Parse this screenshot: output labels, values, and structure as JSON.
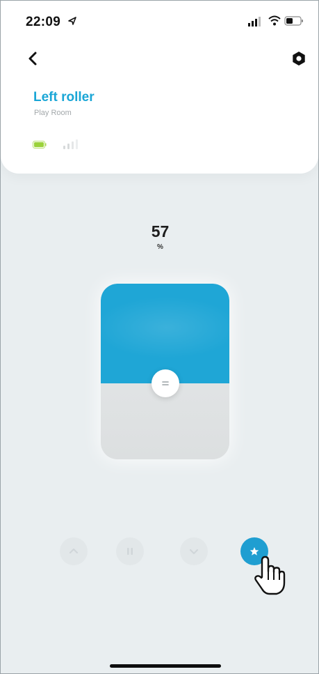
{
  "status_bar": {
    "time": "22:09"
  },
  "device": {
    "name": "Left roller",
    "room": "Play Room"
  },
  "position": {
    "value": "57",
    "unit": "%",
    "level_percent": 57
  },
  "colors": {
    "accent": "#1fa6d6",
    "title": "#1aa6d6",
    "battery": "#9bd23a",
    "background": "#e9eef0"
  },
  "icons": {
    "back": "chevron-left-icon",
    "settings": "gear-icon",
    "open": "chevron-up-icon",
    "stop": "pause-icon",
    "close": "chevron-down-icon",
    "favorite": "star-icon"
  }
}
